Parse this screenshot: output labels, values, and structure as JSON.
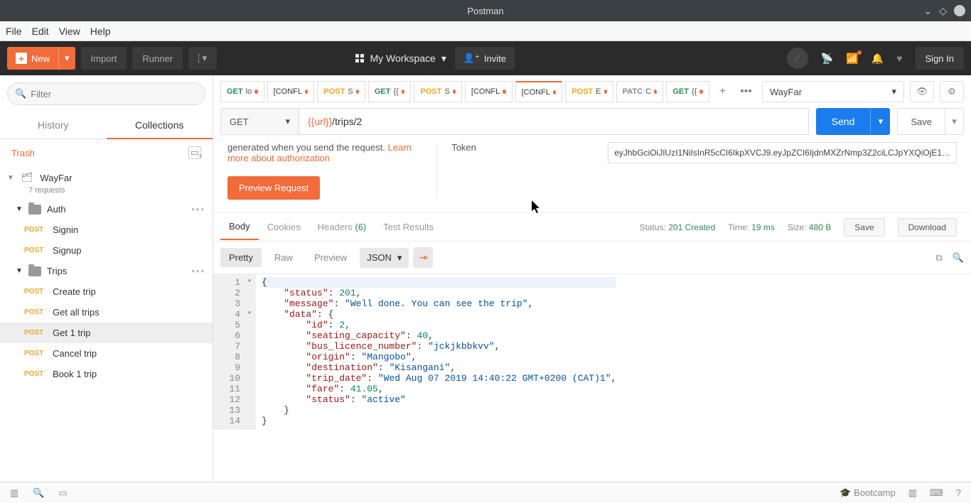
{
  "title": "Postman",
  "menu": {
    "file": "File",
    "edit": "Edit",
    "view": "View",
    "help": "Help"
  },
  "toolbar": {
    "new": "New",
    "import": "Import",
    "runner": "Runner",
    "workspace": "My Workspace",
    "invite": "Invite",
    "signin": "Sign In"
  },
  "sidebar": {
    "filter_placeholder": "Filter",
    "tabs": {
      "history": "History",
      "collections": "Collections"
    },
    "trash": "Trash",
    "collection": {
      "name": "WayFar",
      "sub": "7 requests"
    },
    "folders": [
      {
        "name": "Auth",
        "items": [
          {
            "method": "POST",
            "name": "Signin"
          },
          {
            "method": "POST",
            "name": "Signup"
          }
        ]
      },
      {
        "name": "Trips",
        "items": [
          {
            "method": "POST",
            "name": "Create trip"
          },
          {
            "method": "POST",
            "name": "Get all trips"
          },
          {
            "method": "POST",
            "name": "Get 1 trip",
            "active": true
          },
          {
            "method": "POST",
            "name": "Cancel trip"
          },
          {
            "method": "POST",
            "name": "Book 1 trip"
          }
        ]
      }
    ]
  },
  "tabs": [
    {
      "method": "GET",
      "label": "lo"
    },
    {
      "method": "CONF",
      "label": "[CONFL"
    },
    {
      "method": "POST",
      "label": "S"
    },
    {
      "method": "GET",
      "label": "{{"
    },
    {
      "method": "POST",
      "label": "S"
    },
    {
      "method": "CONF",
      "label": "[CONFL"
    },
    {
      "method": "CONF",
      "label": "[CONFL",
      "active": true
    },
    {
      "method": "POST",
      "label": "E"
    },
    {
      "method": "PATCH",
      "label": "C"
    },
    {
      "method": "GET",
      "label": "{{"
    }
  ],
  "env": {
    "selected": "WayFar"
  },
  "request": {
    "method": "GET",
    "url_var": "{{url}}",
    "url_path": "/trips/2",
    "send": "Send",
    "save": "Save",
    "auth_text_prefix": "generated when you send the request. ",
    "auth_link": "Learn more about authorization",
    "preview_button": "Preview Request",
    "token_label": "Token",
    "token_value": "eyJhbGciOiJIUzI1NiIsInR5cCI6IkpXVCJ9.eyJpZCI6IjdnMXZrNmp3Z2ciLCJpYXQiOjE1…"
  },
  "response": {
    "tabs": {
      "body": "Body",
      "cookies": "Cookies",
      "headers": "Headers",
      "headers_count": "(6)",
      "tests": "Test Results"
    },
    "status_label": "Status:",
    "status_value": "201 Created",
    "time_label": "Time:",
    "time_value": "19 ms",
    "size_label": "Size:",
    "size_value": "480 B",
    "save": "Save",
    "download": "Download",
    "view": {
      "pretty": "Pretty",
      "raw": "Raw",
      "preview": "Preview",
      "lang": "JSON"
    },
    "body_json": {
      "status": 201,
      "message": "Well done. You can see the trip",
      "data": {
        "id": 2,
        "seating_capacity": 40,
        "bus_licence_number": "jckjkbbkvv",
        "origin": "Mangobo",
        "destination": "Kisangani",
        "trip_date": "Wed Aug 07 2019 14:40:22 GMT+0200 (CAT)1",
        "fare": 41.05,
        "status": "active"
      }
    }
  },
  "statusbar": {
    "bootcamp": "Bootcamp"
  }
}
